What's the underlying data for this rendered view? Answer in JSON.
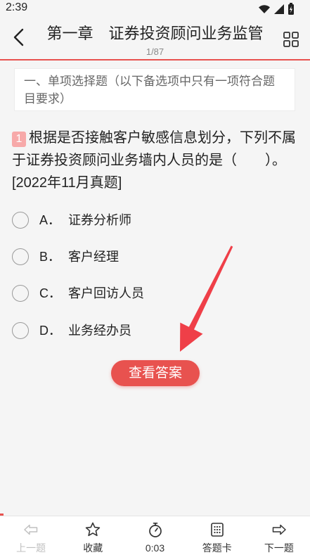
{
  "status_bar": {
    "time": "2:39",
    "icons": [
      "wifi-icon",
      "signal-icon",
      "battery-icon"
    ]
  },
  "header": {
    "title": "第一章　证券投资顾问业务监管",
    "progress_text": "1/87",
    "back_icon": "chevron-left-icon",
    "grid_icon": "grid-icon"
  },
  "progress_bar": {
    "fraction": 0.0115
  },
  "section": {
    "title": "一、单项选择题（以下备选项中只有一项符合题目要求）"
  },
  "question": {
    "number": "1",
    "text": "根据是否接触客户敏感信息划分，下列不属于证券投资顾问业务墙内人员的是（　　）。[2022年11月真题]"
  },
  "options": [
    {
      "letter": "A．",
      "text": "证券分析师"
    },
    {
      "letter": "B．",
      "text": "客户经理"
    },
    {
      "letter": "C．",
      "text": "客户回访人员"
    },
    {
      "letter": "D．",
      "text": "业务经办员"
    }
  ],
  "show_answer": {
    "label": "查看答案"
  },
  "toolbar": {
    "prev": {
      "label": "上一题",
      "icon": "left-arrow-icon",
      "enabled": false
    },
    "favorite": {
      "label": "收藏",
      "icon": "star-icon"
    },
    "timer": {
      "label": "0:03",
      "icon": "stopwatch-icon"
    },
    "answer_card": {
      "label": "答题卡",
      "icon": "answer-card-icon"
    },
    "next": {
      "label": "下一题",
      "icon": "right-arrow-icon"
    }
  },
  "colors": {
    "accent": "#e8524f",
    "badge": "#f7a9a9",
    "disabled": "#c0c0c0",
    "arrow": "#ef3f48"
  }
}
